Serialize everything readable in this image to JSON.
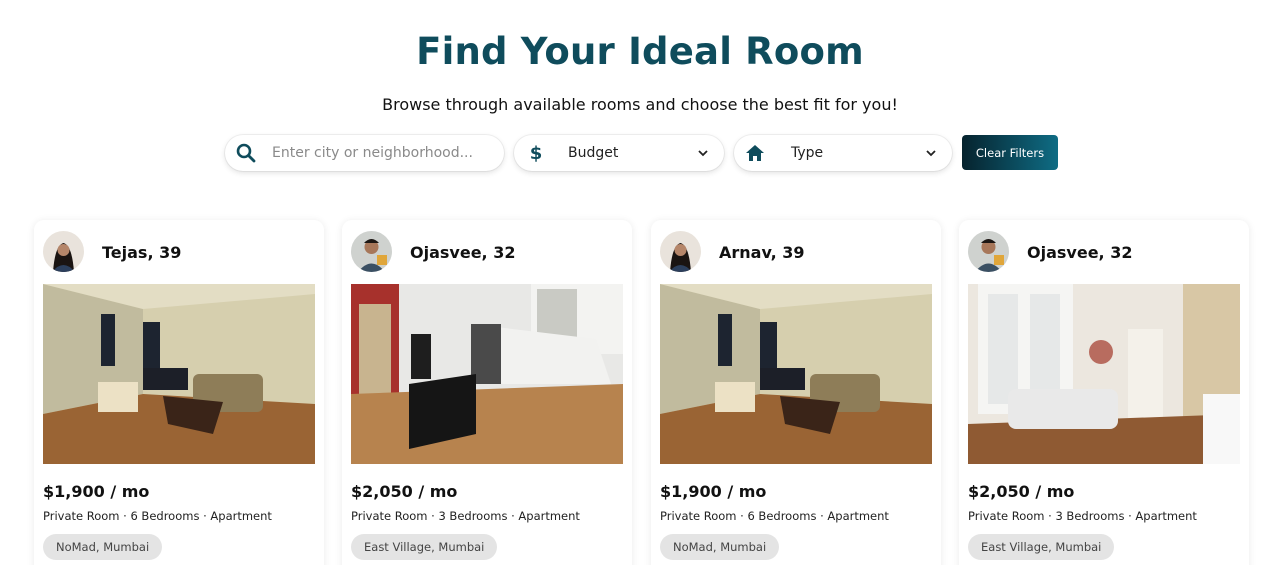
{
  "page": {
    "title": "Find Your Ideal Room",
    "subtitle": "Browse through available rooms and choose the best fit for you!"
  },
  "filters": {
    "search_placeholder": "Enter city or neighborhood...",
    "budget_label": "Budget",
    "type_label": "Type",
    "clear_label": "Clear Filters",
    "icons": [
      "search-icon",
      "dollar-icon",
      "home-icon",
      "chevron-down-icon"
    ]
  },
  "colors": {
    "accent": "#0f4c5c",
    "button_gradient_start": "#06232e",
    "button_gradient_end": "#0f6c84",
    "location_chip_bg": "#e4e4e4"
  },
  "listings": [
    {
      "name": "Tejas, 39",
      "price": "$1,900 / mo",
      "details": "Private Room · 6 Bedrooms · Apartment",
      "location": "NoMad, Mumbai"
    },
    {
      "name": "Ojasvee, 32",
      "price": "$2,050 / mo",
      "details": "Private Room · 3 Bedrooms · Apartment",
      "location": "East Village, Mumbai"
    },
    {
      "name": "Arnav, 39",
      "price": "$1,900 / mo",
      "details": "Private Room · 6 Bedrooms · Apartment",
      "location": "NoMad, Mumbai"
    },
    {
      "name": "Ojasvee, 32",
      "price": "$2,050 / mo",
      "details": "Private Room · 3 Bedrooms · Apartment",
      "location": "East Village, Mumbai"
    }
  ]
}
